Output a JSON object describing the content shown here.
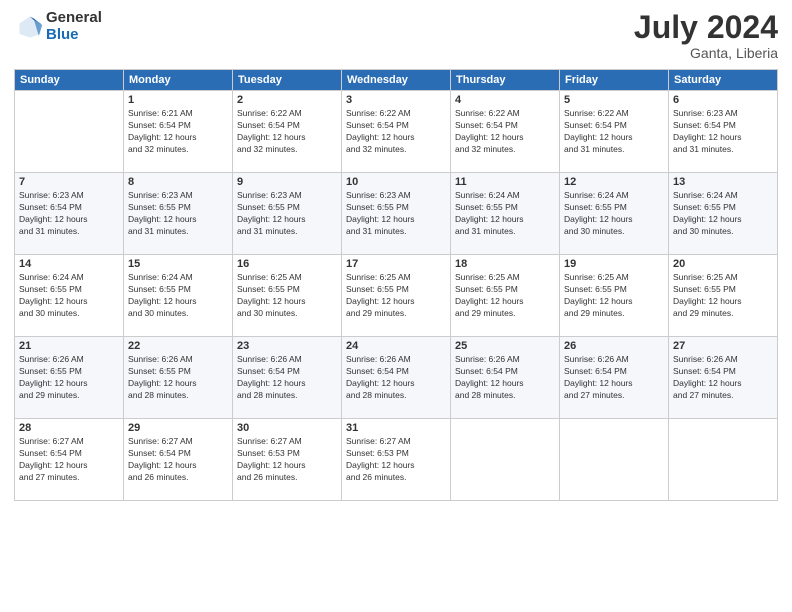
{
  "header": {
    "logo_general": "General",
    "logo_blue": "Blue",
    "month_title": "July 2024",
    "location": "Ganta, Liberia"
  },
  "days_of_week": [
    "Sunday",
    "Monday",
    "Tuesday",
    "Wednesday",
    "Thursday",
    "Friday",
    "Saturday"
  ],
  "weeks": [
    [
      {
        "day": "",
        "info": ""
      },
      {
        "day": "1",
        "info": "Sunrise: 6:21 AM\nSunset: 6:54 PM\nDaylight: 12 hours\nand 32 minutes."
      },
      {
        "day": "2",
        "info": "Sunrise: 6:22 AM\nSunset: 6:54 PM\nDaylight: 12 hours\nand 32 minutes."
      },
      {
        "day": "3",
        "info": "Sunrise: 6:22 AM\nSunset: 6:54 PM\nDaylight: 12 hours\nand 32 minutes."
      },
      {
        "day": "4",
        "info": "Sunrise: 6:22 AM\nSunset: 6:54 PM\nDaylight: 12 hours\nand 32 minutes."
      },
      {
        "day": "5",
        "info": "Sunrise: 6:22 AM\nSunset: 6:54 PM\nDaylight: 12 hours\nand 31 minutes."
      },
      {
        "day": "6",
        "info": "Sunrise: 6:23 AM\nSunset: 6:54 PM\nDaylight: 12 hours\nand 31 minutes."
      }
    ],
    [
      {
        "day": "7",
        "info": "Sunrise: 6:23 AM\nSunset: 6:54 PM\nDaylight: 12 hours\nand 31 minutes."
      },
      {
        "day": "8",
        "info": "Sunrise: 6:23 AM\nSunset: 6:55 PM\nDaylight: 12 hours\nand 31 minutes."
      },
      {
        "day": "9",
        "info": "Sunrise: 6:23 AM\nSunset: 6:55 PM\nDaylight: 12 hours\nand 31 minutes."
      },
      {
        "day": "10",
        "info": "Sunrise: 6:23 AM\nSunset: 6:55 PM\nDaylight: 12 hours\nand 31 minutes."
      },
      {
        "day": "11",
        "info": "Sunrise: 6:24 AM\nSunset: 6:55 PM\nDaylight: 12 hours\nand 31 minutes."
      },
      {
        "day": "12",
        "info": "Sunrise: 6:24 AM\nSunset: 6:55 PM\nDaylight: 12 hours\nand 30 minutes."
      },
      {
        "day": "13",
        "info": "Sunrise: 6:24 AM\nSunset: 6:55 PM\nDaylight: 12 hours\nand 30 minutes."
      }
    ],
    [
      {
        "day": "14",
        "info": "Sunrise: 6:24 AM\nSunset: 6:55 PM\nDaylight: 12 hours\nand 30 minutes."
      },
      {
        "day": "15",
        "info": "Sunrise: 6:24 AM\nSunset: 6:55 PM\nDaylight: 12 hours\nand 30 minutes."
      },
      {
        "day": "16",
        "info": "Sunrise: 6:25 AM\nSunset: 6:55 PM\nDaylight: 12 hours\nand 30 minutes."
      },
      {
        "day": "17",
        "info": "Sunrise: 6:25 AM\nSunset: 6:55 PM\nDaylight: 12 hours\nand 29 minutes."
      },
      {
        "day": "18",
        "info": "Sunrise: 6:25 AM\nSunset: 6:55 PM\nDaylight: 12 hours\nand 29 minutes."
      },
      {
        "day": "19",
        "info": "Sunrise: 6:25 AM\nSunset: 6:55 PM\nDaylight: 12 hours\nand 29 minutes."
      },
      {
        "day": "20",
        "info": "Sunrise: 6:25 AM\nSunset: 6:55 PM\nDaylight: 12 hours\nand 29 minutes."
      }
    ],
    [
      {
        "day": "21",
        "info": "Sunrise: 6:26 AM\nSunset: 6:55 PM\nDaylight: 12 hours\nand 29 minutes."
      },
      {
        "day": "22",
        "info": "Sunrise: 6:26 AM\nSunset: 6:55 PM\nDaylight: 12 hours\nand 28 minutes."
      },
      {
        "day": "23",
        "info": "Sunrise: 6:26 AM\nSunset: 6:54 PM\nDaylight: 12 hours\nand 28 minutes."
      },
      {
        "day": "24",
        "info": "Sunrise: 6:26 AM\nSunset: 6:54 PM\nDaylight: 12 hours\nand 28 minutes."
      },
      {
        "day": "25",
        "info": "Sunrise: 6:26 AM\nSunset: 6:54 PM\nDaylight: 12 hours\nand 28 minutes."
      },
      {
        "day": "26",
        "info": "Sunrise: 6:26 AM\nSunset: 6:54 PM\nDaylight: 12 hours\nand 27 minutes."
      },
      {
        "day": "27",
        "info": "Sunrise: 6:26 AM\nSunset: 6:54 PM\nDaylight: 12 hours\nand 27 minutes."
      }
    ],
    [
      {
        "day": "28",
        "info": "Sunrise: 6:27 AM\nSunset: 6:54 PM\nDaylight: 12 hours\nand 27 minutes."
      },
      {
        "day": "29",
        "info": "Sunrise: 6:27 AM\nSunset: 6:54 PM\nDaylight: 12 hours\nand 26 minutes."
      },
      {
        "day": "30",
        "info": "Sunrise: 6:27 AM\nSunset: 6:53 PM\nDaylight: 12 hours\nand 26 minutes."
      },
      {
        "day": "31",
        "info": "Sunrise: 6:27 AM\nSunset: 6:53 PM\nDaylight: 12 hours\nand 26 minutes."
      },
      {
        "day": "",
        "info": ""
      },
      {
        "day": "",
        "info": ""
      },
      {
        "day": "",
        "info": ""
      }
    ]
  ]
}
